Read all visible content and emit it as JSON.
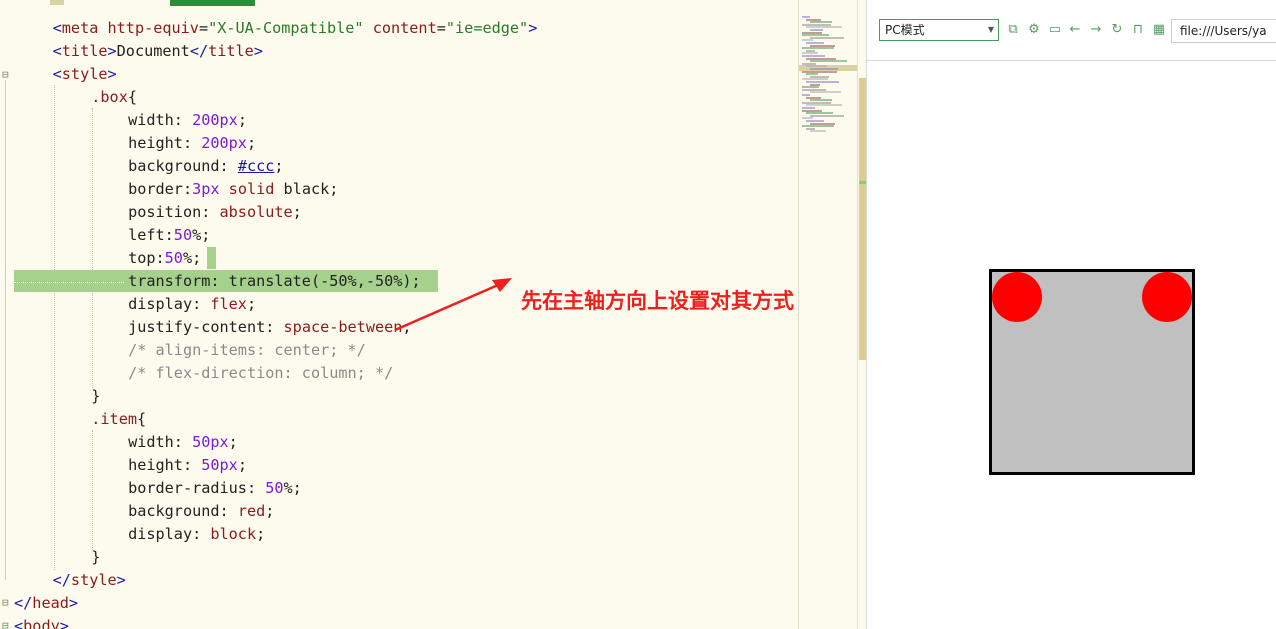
{
  "editor": {
    "lines": [
      {
        "tokens": [
          [
            "tag",
            "<"
          ],
          [
            "tname",
            "meta"
          ],
          [
            "p",
            " "
          ],
          [
            "attr",
            "http-equiv"
          ],
          [
            "p",
            "="
          ],
          [
            "str",
            "\"X-UA-Compatible\""
          ],
          [
            "p",
            " "
          ],
          [
            "attr",
            "content"
          ],
          [
            "p",
            "="
          ],
          [
            "str",
            "\"ie=edge\""
          ],
          [
            "tag",
            ">"
          ]
        ]
      },
      {
        "tokens": [
          [
            "tag",
            "<"
          ],
          [
            "tname",
            "title"
          ],
          [
            "tag",
            ">"
          ],
          [
            "p",
            "Document"
          ],
          [
            "tag",
            "</"
          ],
          [
            "tname",
            "title"
          ],
          [
            "tag",
            ">"
          ]
        ]
      },
      {
        "tokens": [
          [
            "tag",
            "<"
          ],
          [
            "tname",
            "style"
          ],
          [
            "tag",
            ">"
          ]
        ]
      },
      {
        "tokens": [
          [
            "sel",
            ".box"
          ],
          [
            "p",
            "{"
          ]
        ]
      },
      {
        "tokens": [
          [
            "prop",
            "width: "
          ],
          [
            "num",
            "200px"
          ],
          [
            "p",
            ";"
          ]
        ]
      },
      {
        "tokens": [
          [
            "prop",
            "height: "
          ],
          [
            "num",
            "200px"
          ],
          [
            "p",
            ";"
          ]
        ]
      },
      {
        "tokens": [
          [
            "prop",
            "background: "
          ],
          [
            "col",
            "#ccc"
          ],
          [
            "p",
            ";"
          ]
        ]
      },
      {
        "tokens": [
          [
            "prop",
            "border:"
          ],
          [
            "num",
            "3px"
          ],
          [
            "kw",
            " solid"
          ],
          [
            "p",
            " black;"
          ]
        ]
      },
      {
        "tokens": [
          [
            "prop",
            "position: "
          ],
          [
            "kw",
            "absolute"
          ],
          [
            "p",
            ";"
          ]
        ]
      },
      {
        "tokens": [
          [
            "prop",
            "left:"
          ],
          [
            "num",
            "50"
          ],
          [
            "p",
            "%;"
          ]
        ]
      },
      {
        "tokens": [
          [
            "prop",
            "top:"
          ],
          [
            "num",
            "50"
          ],
          [
            "p",
            "%;"
          ]
        ]
      },
      {
        "tokens": [
          [
            "prop",
            "transform: translate(-50%,-50%);"
          ]
        ]
      },
      {
        "tokens": [
          [
            "prop",
            "display: "
          ],
          [
            "kw",
            "flex"
          ],
          [
            "p",
            ";"
          ]
        ]
      },
      {
        "tokens": [
          [
            "prop",
            "justify-content: "
          ],
          [
            "kw",
            "space-between"
          ],
          [
            "p",
            ";"
          ]
        ]
      },
      {
        "tokens": [
          [
            "cmt",
            "/* align-items: center; */"
          ]
        ]
      },
      {
        "tokens": [
          [
            "cmt",
            "/* flex-direction: column; */"
          ]
        ]
      },
      {
        "tokens": [
          [
            "p",
            "}"
          ]
        ]
      },
      {
        "tokens": [
          [
            "sel",
            ".item"
          ],
          [
            "p",
            "{"
          ]
        ]
      },
      {
        "tokens": [
          [
            "prop",
            "width: "
          ],
          [
            "num",
            "50px"
          ],
          [
            "p",
            ";"
          ]
        ]
      },
      {
        "tokens": [
          [
            "prop",
            "height: "
          ],
          [
            "num",
            "50px"
          ],
          [
            "p",
            ";"
          ]
        ]
      },
      {
        "tokens": [
          [
            "prop",
            "border-radius: "
          ],
          [
            "num",
            "50"
          ],
          [
            "p",
            "%;"
          ]
        ]
      },
      {
        "tokens": [
          [
            "prop",
            "background: "
          ],
          [
            "kw",
            "red"
          ],
          [
            "p",
            ";"
          ]
        ]
      },
      {
        "tokens": [
          [
            "prop",
            "display: "
          ],
          [
            "kw",
            "block"
          ],
          [
            "p",
            ";"
          ]
        ]
      },
      {
        "tokens": [
          [
            "p",
            "}"
          ]
        ]
      },
      {
        "tokens": [
          [
            "tag",
            "</"
          ],
          [
            "tname",
            "style"
          ],
          [
            "tag",
            ">"
          ]
        ]
      },
      {
        "tokens": [
          [
            "tag",
            "</"
          ],
          [
            "tname",
            "head"
          ],
          [
            "tag",
            ">"
          ]
        ]
      },
      {
        "tokens": [
          [
            "tag",
            "<"
          ],
          [
            "tname",
            "body"
          ],
          [
            "tag",
            ">"
          ]
        ]
      }
    ]
  },
  "annotation": {
    "text": "先在主轴方向上设置对其方式",
    "color": "#ef1f1f"
  },
  "preview": {
    "mode_select": "PC模式",
    "url": "file:///Users/ya",
    "toolbar_icons": [
      "open-external-icon",
      "settings-gear-icon",
      "terminal-icon",
      "back-arrow-icon",
      "forward-arrow-icon",
      "refresh-icon",
      "lock-icon",
      "qr-code-icon"
    ],
    "demo_colors": {
      "box": "#c0c0c0",
      "item": "#ff0000",
      "border": "#000000"
    }
  }
}
